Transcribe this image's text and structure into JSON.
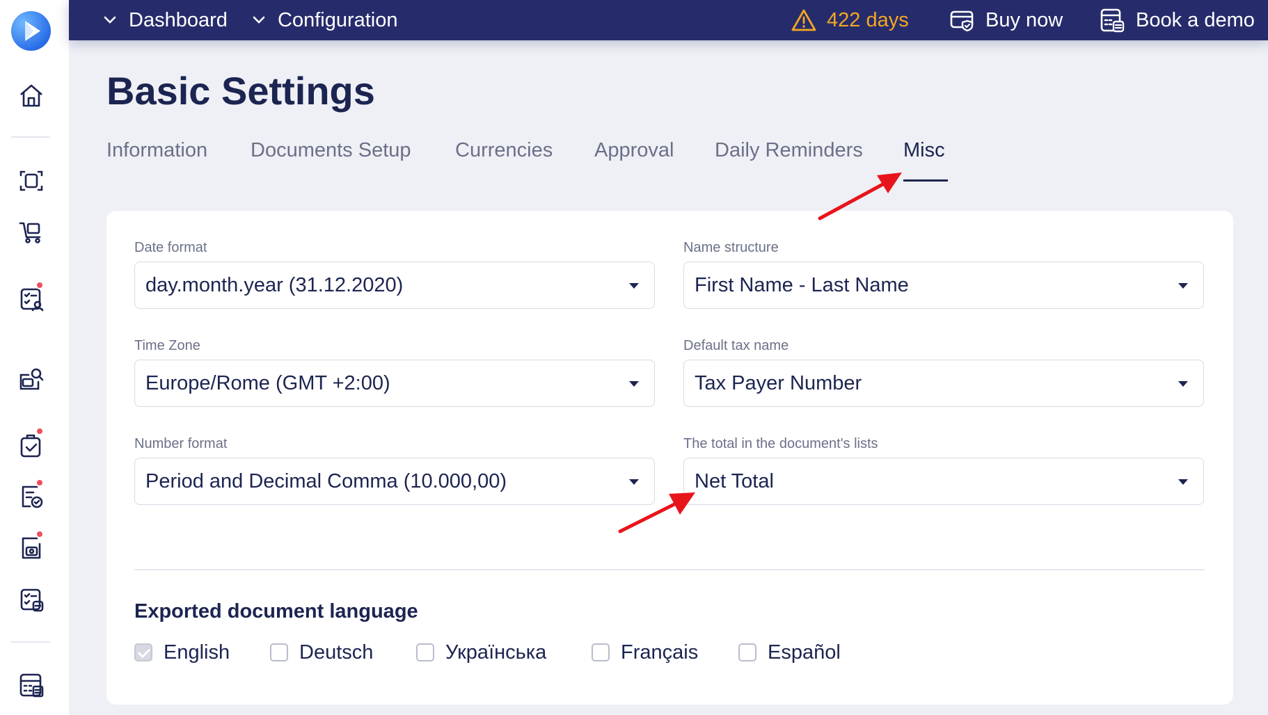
{
  "topbar": {
    "nav": [
      {
        "label": "Dashboard",
        "icon": "chevron-down-icon"
      },
      {
        "label": "Configuration",
        "icon": "chevron-down-icon"
      }
    ],
    "trial_days": "422 days",
    "buy_now": "Buy now",
    "book_demo": "Book a demo"
  },
  "page": {
    "title": "Basic Settings"
  },
  "tabs": [
    {
      "label": "Information"
    },
    {
      "label": "Documents Setup"
    },
    {
      "label": "Currencies"
    },
    {
      "label": "Approval"
    },
    {
      "label": "Daily Reminders"
    },
    {
      "label": "Misc",
      "active": true
    }
  ],
  "fields": {
    "date_format": {
      "label": "Date format",
      "value": "day.month.year (31.12.2020)"
    },
    "name_structure": {
      "label": "Name structure",
      "value": "First Name - Last Name"
    },
    "time_zone": {
      "label": "Time Zone",
      "value": "Europe/Rome (GMT +2:00)"
    },
    "default_tax_name": {
      "label": "Default tax name",
      "value": "Tax Payer Number"
    },
    "number_format": {
      "label": "Number format",
      "value": "Period and Decimal Comma (10.000,00)"
    },
    "document_total": {
      "label": "The total in the document's lists",
      "value": "Net Total"
    }
  },
  "export_language": {
    "title": "Exported document language",
    "options": [
      {
        "label": "English",
        "checked": true
      },
      {
        "label": "Deutsch",
        "checked": false
      },
      {
        "label": "Українська",
        "checked": false
      },
      {
        "label": "Français",
        "checked": false
      },
      {
        "label": "Español",
        "checked": false
      }
    ]
  },
  "colors": {
    "topbar": "#262c6b",
    "accent_warning": "#f5a623",
    "notification_dot": "#ef4e5e",
    "annotation_arrow": "#e8141c"
  },
  "sidebar_icons": [
    "home-icon",
    "scan-icon",
    "cart-icon",
    "list-user-icon",
    "search-folder-icon",
    "clipboard-check-icon",
    "doc-check-icon",
    "camera-doc-icon",
    "list-money-icon",
    "calculator-icon"
  ]
}
